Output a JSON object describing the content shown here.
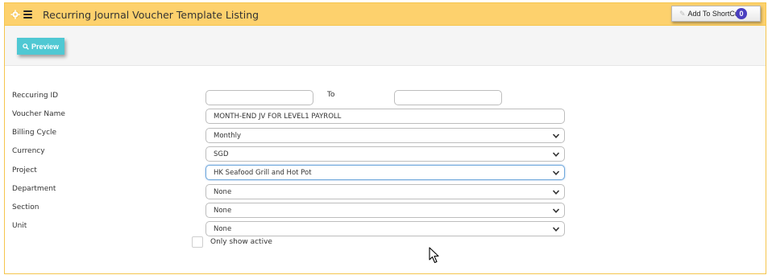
{
  "header": {
    "title": "Recurring Journal Voucher Template Listing",
    "shortcut_label": "Add To ShortCut",
    "shortcut_count": "0"
  },
  "toolbar": {
    "preview_label": "Preview"
  },
  "form": {
    "recurring_id": {
      "label": "Reccuring ID",
      "from_value": "",
      "to_label": "To",
      "to_value": ""
    },
    "voucher_name": {
      "label": "Voucher Name",
      "value": "MONTH-END JV FOR  LEVEL1 PAYROLL"
    },
    "billing_cycle": {
      "label": "Billing Cycle",
      "value": "Monthly"
    },
    "currency": {
      "label": "Currency",
      "value": "SGD"
    },
    "project": {
      "label": "Project",
      "value": "HK Seafood Grill and Hot Pot"
    },
    "department": {
      "label": "Department",
      "value": "None"
    },
    "section": {
      "label": "Section",
      "value": "None"
    },
    "unit": {
      "label": "Unit",
      "value": "None"
    },
    "only_active": {
      "label": "Only show active",
      "checked": false
    }
  },
  "colors": {
    "header_bg": "#fdd16d",
    "panel_border": "#f5c54d",
    "preview_bg": "#4fc8d3",
    "badge_bg": "#4b3fbf"
  },
  "icons": [
    "gear-icon",
    "menu-icon",
    "pencil-icon",
    "search-icon",
    "chevron-down-icon",
    "mouse-cursor-icon"
  ]
}
